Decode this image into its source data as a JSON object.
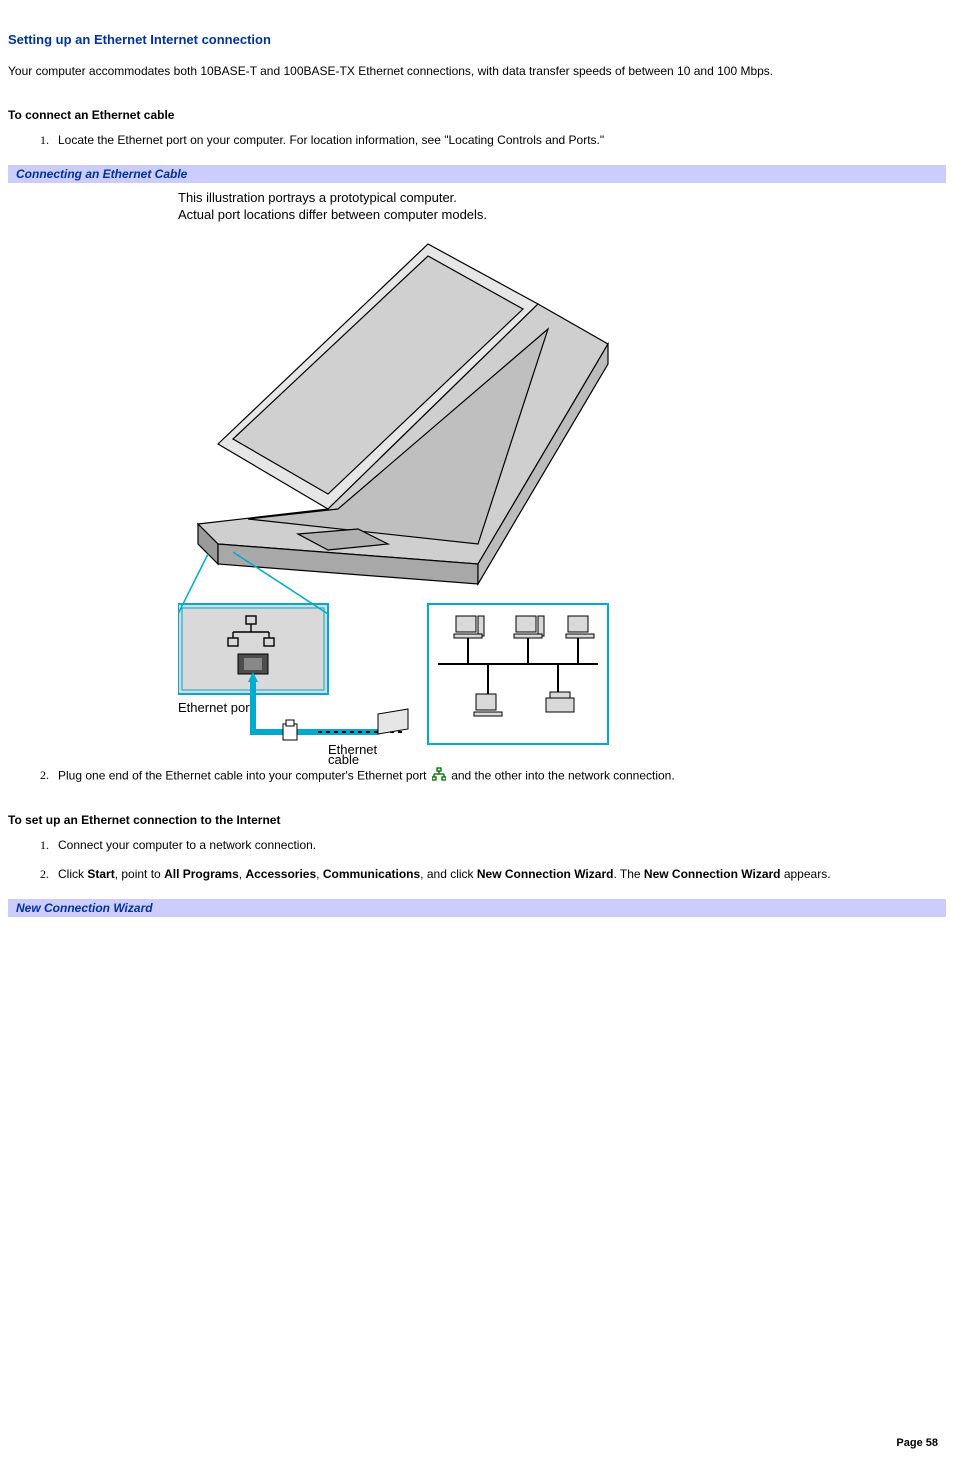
{
  "section_title": "Setting up an Ethernet Internet connection",
  "intro": "Your computer accommodates both 10BASE-T and 100BASE-TX Ethernet connections, with data transfer speeds of between 10 and 100 Mbps.",
  "sub1_heading": "To connect an Ethernet cable",
  "sub1_steps": {
    "s1": "Locate the Ethernet port on your computer. For location information, see \"Locating Controls and Ports.\"",
    "s2_a": "Plug one end of the Ethernet cable into your computer's Ethernet port ",
    "s2_b": "and the other into the network connection."
  },
  "caption1": "Connecting an Ethernet Cable",
  "illus_note_line1": "This illustration portrays a prototypical computer.",
  "illus_note_line2": "Actual port locations differ between computer models.",
  "illus_labels": {
    "ethernet_port": "Ethernet port",
    "ethernet_cable": "Ethernet",
    "cable_word": "cable"
  },
  "sub2_heading": "To set up an Ethernet connection to the Internet",
  "sub2_steps": {
    "s1": "Connect your computer to a network connection.",
    "s2_pre": "Click ",
    "s2_start": "Start",
    "s2_a": ", point to ",
    "s2_allprograms": "All Programs",
    "s2_b": ", ",
    "s2_accessories": "Accessories",
    "s2_c": ", ",
    "s2_communications": "Communications",
    "s2_d": ", and click ",
    "s2_ncw": "New Connection Wizard",
    "s2_e": ". The ",
    "s2_ncw2": "New Connection Wizard",
    "s2_f": " appears."
  },
  "caption2": "New Connection Wizard",
  "page_label": "Page 58"
}
